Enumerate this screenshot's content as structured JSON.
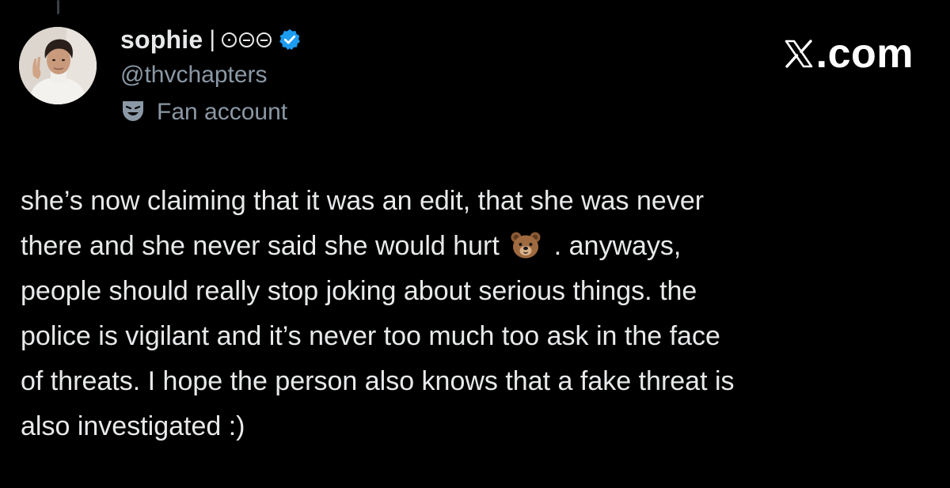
{
  "tweet": {
    "author": {
      "display_name": "sophie",
      "name_suffix": "|",
      "name_icons": [
        "circle-dot-icon",
        "circle-dash-icon",
        "circle-dash-icon"
      ],
      "verified": true,
      "verified_color": "#1d9bf0",
      "handle": "@thvchapters",
      "label_icon": "theater-mask-icon",
      "label": "Fan account"
    },
    "brand": {
      "x_icon": "x-logo-icon",
      "text": ".com"
    },
    "body": {
      "line1": "she’s now claiming that it was an edit, that she was never",
      "line2_before_emoji": "there and she never said she would hurt",
      "emoji": "bear-face-emoji",
      "line2_after_emoji": ". anyways,",
      "line3": "people should really stop joking about serious things. the",
      "line4": "police is vigilant and it’s never too much too ask in the face",
      "line5": "of threats. I hope the person also knows that a fake threat is",
      "line6": "also investigated :)"
    }
  },
  "colors": {
    "background": "#000000",
    "primary_text": "#e7e9ea",
    "secondary_text": "#8b98a5",
    "thread_line": "#3a3f44"
  }
}
